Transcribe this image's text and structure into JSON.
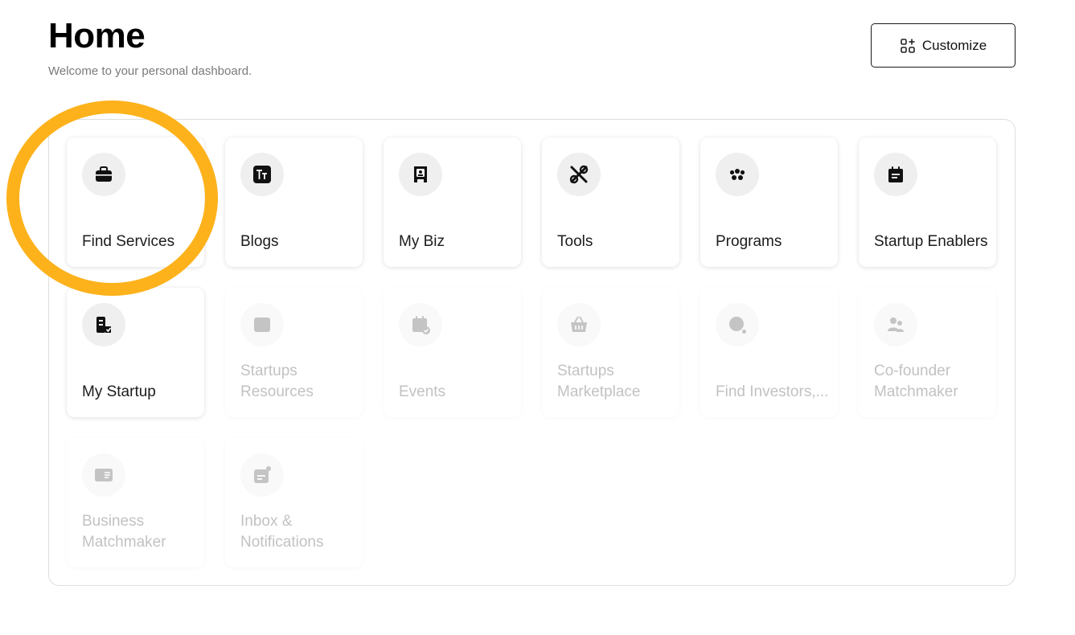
{
  "header": {
    "title": "Home",
    "subtitle": "Welcome to your personal dashboard.",
    "customize_label": "Customize"
  },
  "highlight": {
    "color": "#FDB21C",
    "target": "Find Services"
  },
  "tiles": [
    {
      "label": "Find Services",
      "icon": "briefcase-icon",
      "active": true
    },
    {
      "label": "Blogs",
      "icon": "text-format-icon",
      "active": true
    },
    {
      "label": "My Biz",
      "icon": "id-badge-icon",
      "active": true
    },
    {
      "label": "Tools",
      "icon": "tools-icon",
      "active": true
    },
    {
      "label": "Programs",
      "icon": "group-icon",
      "active": true
    },
    {
      "label": "Startup Enablers",
      "icon": "notebook-icon",
      "active": true
    },
    {
      "label": "My Startup",
      "icon": "startup-icon",
      "active": true
    },
    {
      "label": "Startups Resources",
      "icon": "book-icon",
      "active": false
    },
    {
      "label": "Events",
      "icon": "calendar-check-icon",
      "active": false
    },
    {
      "label": "Startups Marketplace",
      "icon": "basket-icon",
      "active": false
    },
    {
      "label": "Find Investors,...",
      "icon": "search-dot-icon",
      "active": false
    },
    {
      "label": "Co-founder Matchmaker",
      "icon": "users-icon",
      "active": false
    },
    {
      "label": "Business Matchmaker",
      "icon": "id-card-icon",
      "active": false
    },
    {
      "label": "Inbox & Notifications",
      "icon": "notification-icon",
      "active": false
    }
  ],
  "colors": {
    "active_text": "#1c1c1c",
    "inactive_text": "#c2c2c2",
    "icon_bg": "#efefef",
    "accent": "#FDB21C"
  }
}
